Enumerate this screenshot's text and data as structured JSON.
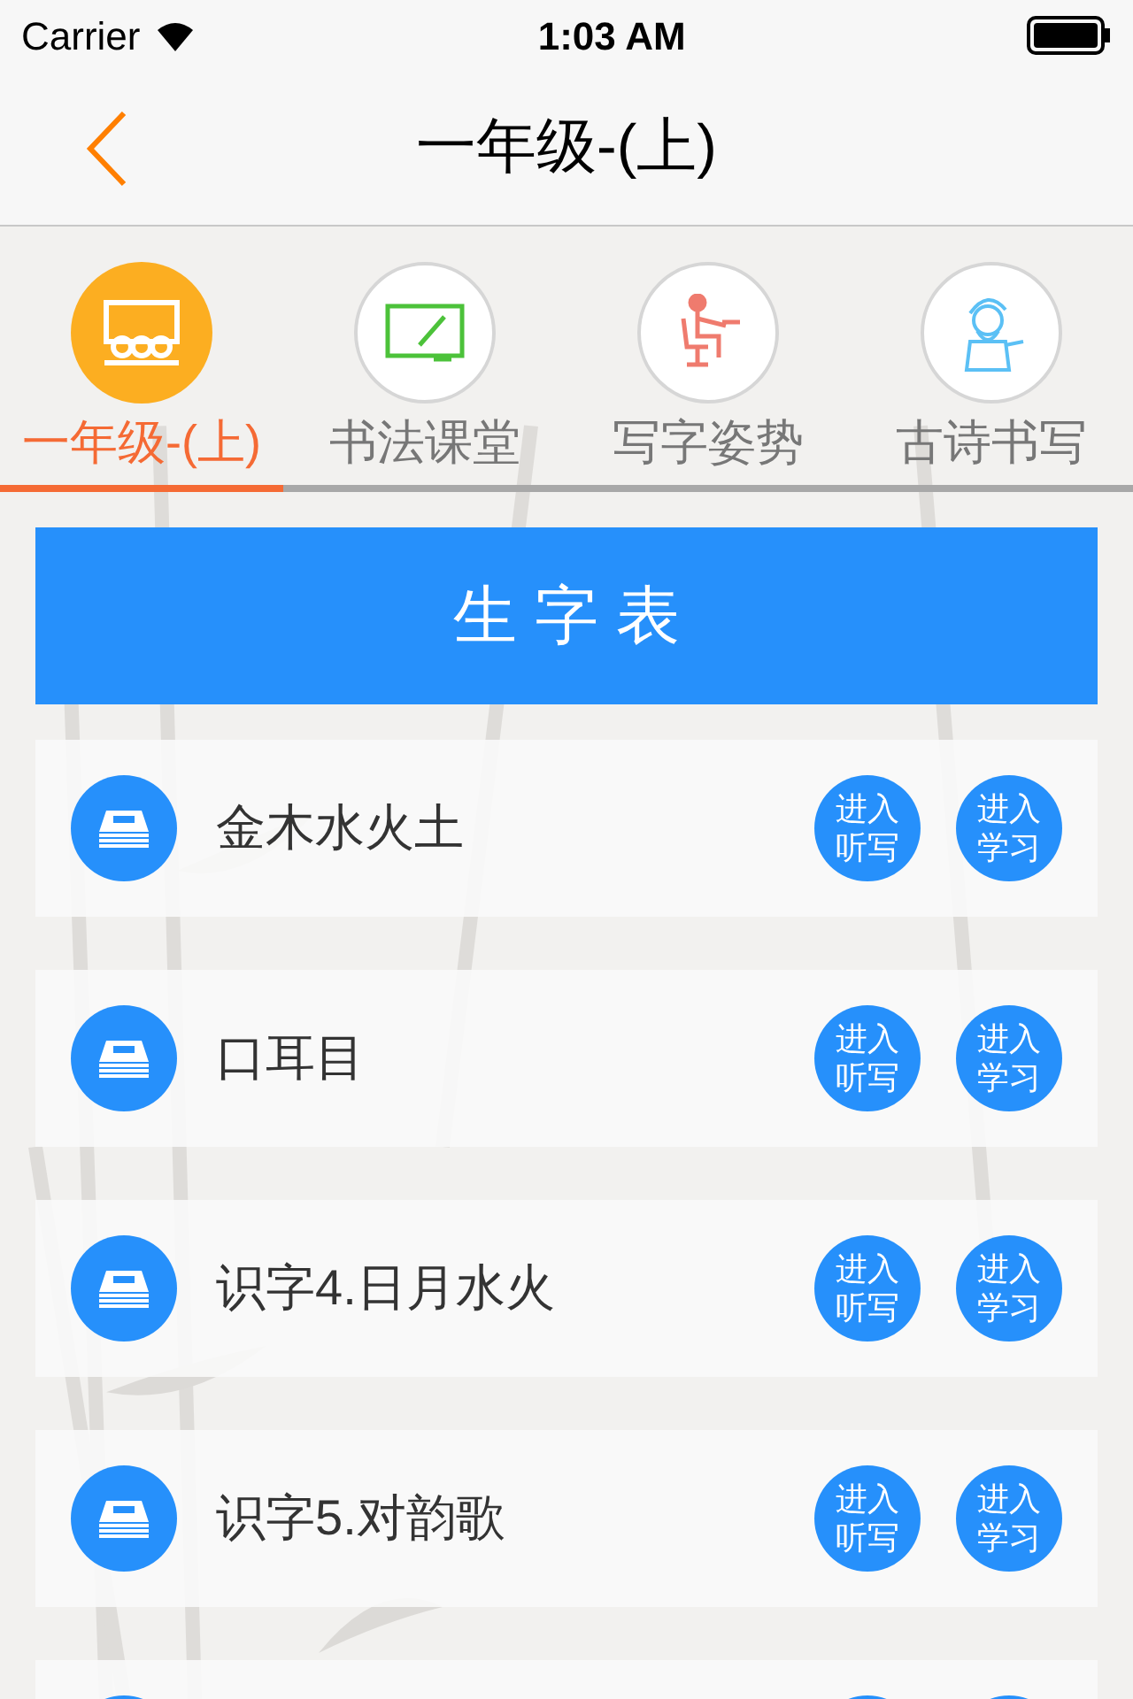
{
  "status_bar": {
    "carrier": "Carrier",
    "time": "1:03 AM"
  },
  "nav": {
    "title": "一年级-(上)"
  },
  "tabs": [
    {
      "label": "一年级-(上)",
      "kind": "classroom",
      "selected": true
    },
    {
      "label": "书法课堂",
      "kind": "board",
      "selected": false
    },
    {
      "label": "写字姿势",
      "kind": "posture",
      "selected": false
    },
    {
      "label": "古诗书写",
      "kind": "poet",
      "selected": false
    }
  ],
  "header": {
    "title": "生 字 表"
  },
  "lessons": [
    {
      "kind": "lesson",
      "title": "金木水火土",
      "buttons": [
        "进入听写",
        "进入学习"
      ]
    },
    {
      "kind": "lesson",
      "title": "口耳目",
      "buttons": [
        "进入听写",
        "进入学习"
      ]
    },
    {
      "kind": "lesson",
      "title": "识字4.日月水火",
      "buttons": [
        "进入听写",
        "进入学习"
      ]
    },
    {
      "kind": "lesson",
      "title": "识字5.对韵歌",
      "buttons": [
        "进入听写",
        "进入学习"
      ]
    },
    {
      "kind": "partial"
    }
  ]
}
